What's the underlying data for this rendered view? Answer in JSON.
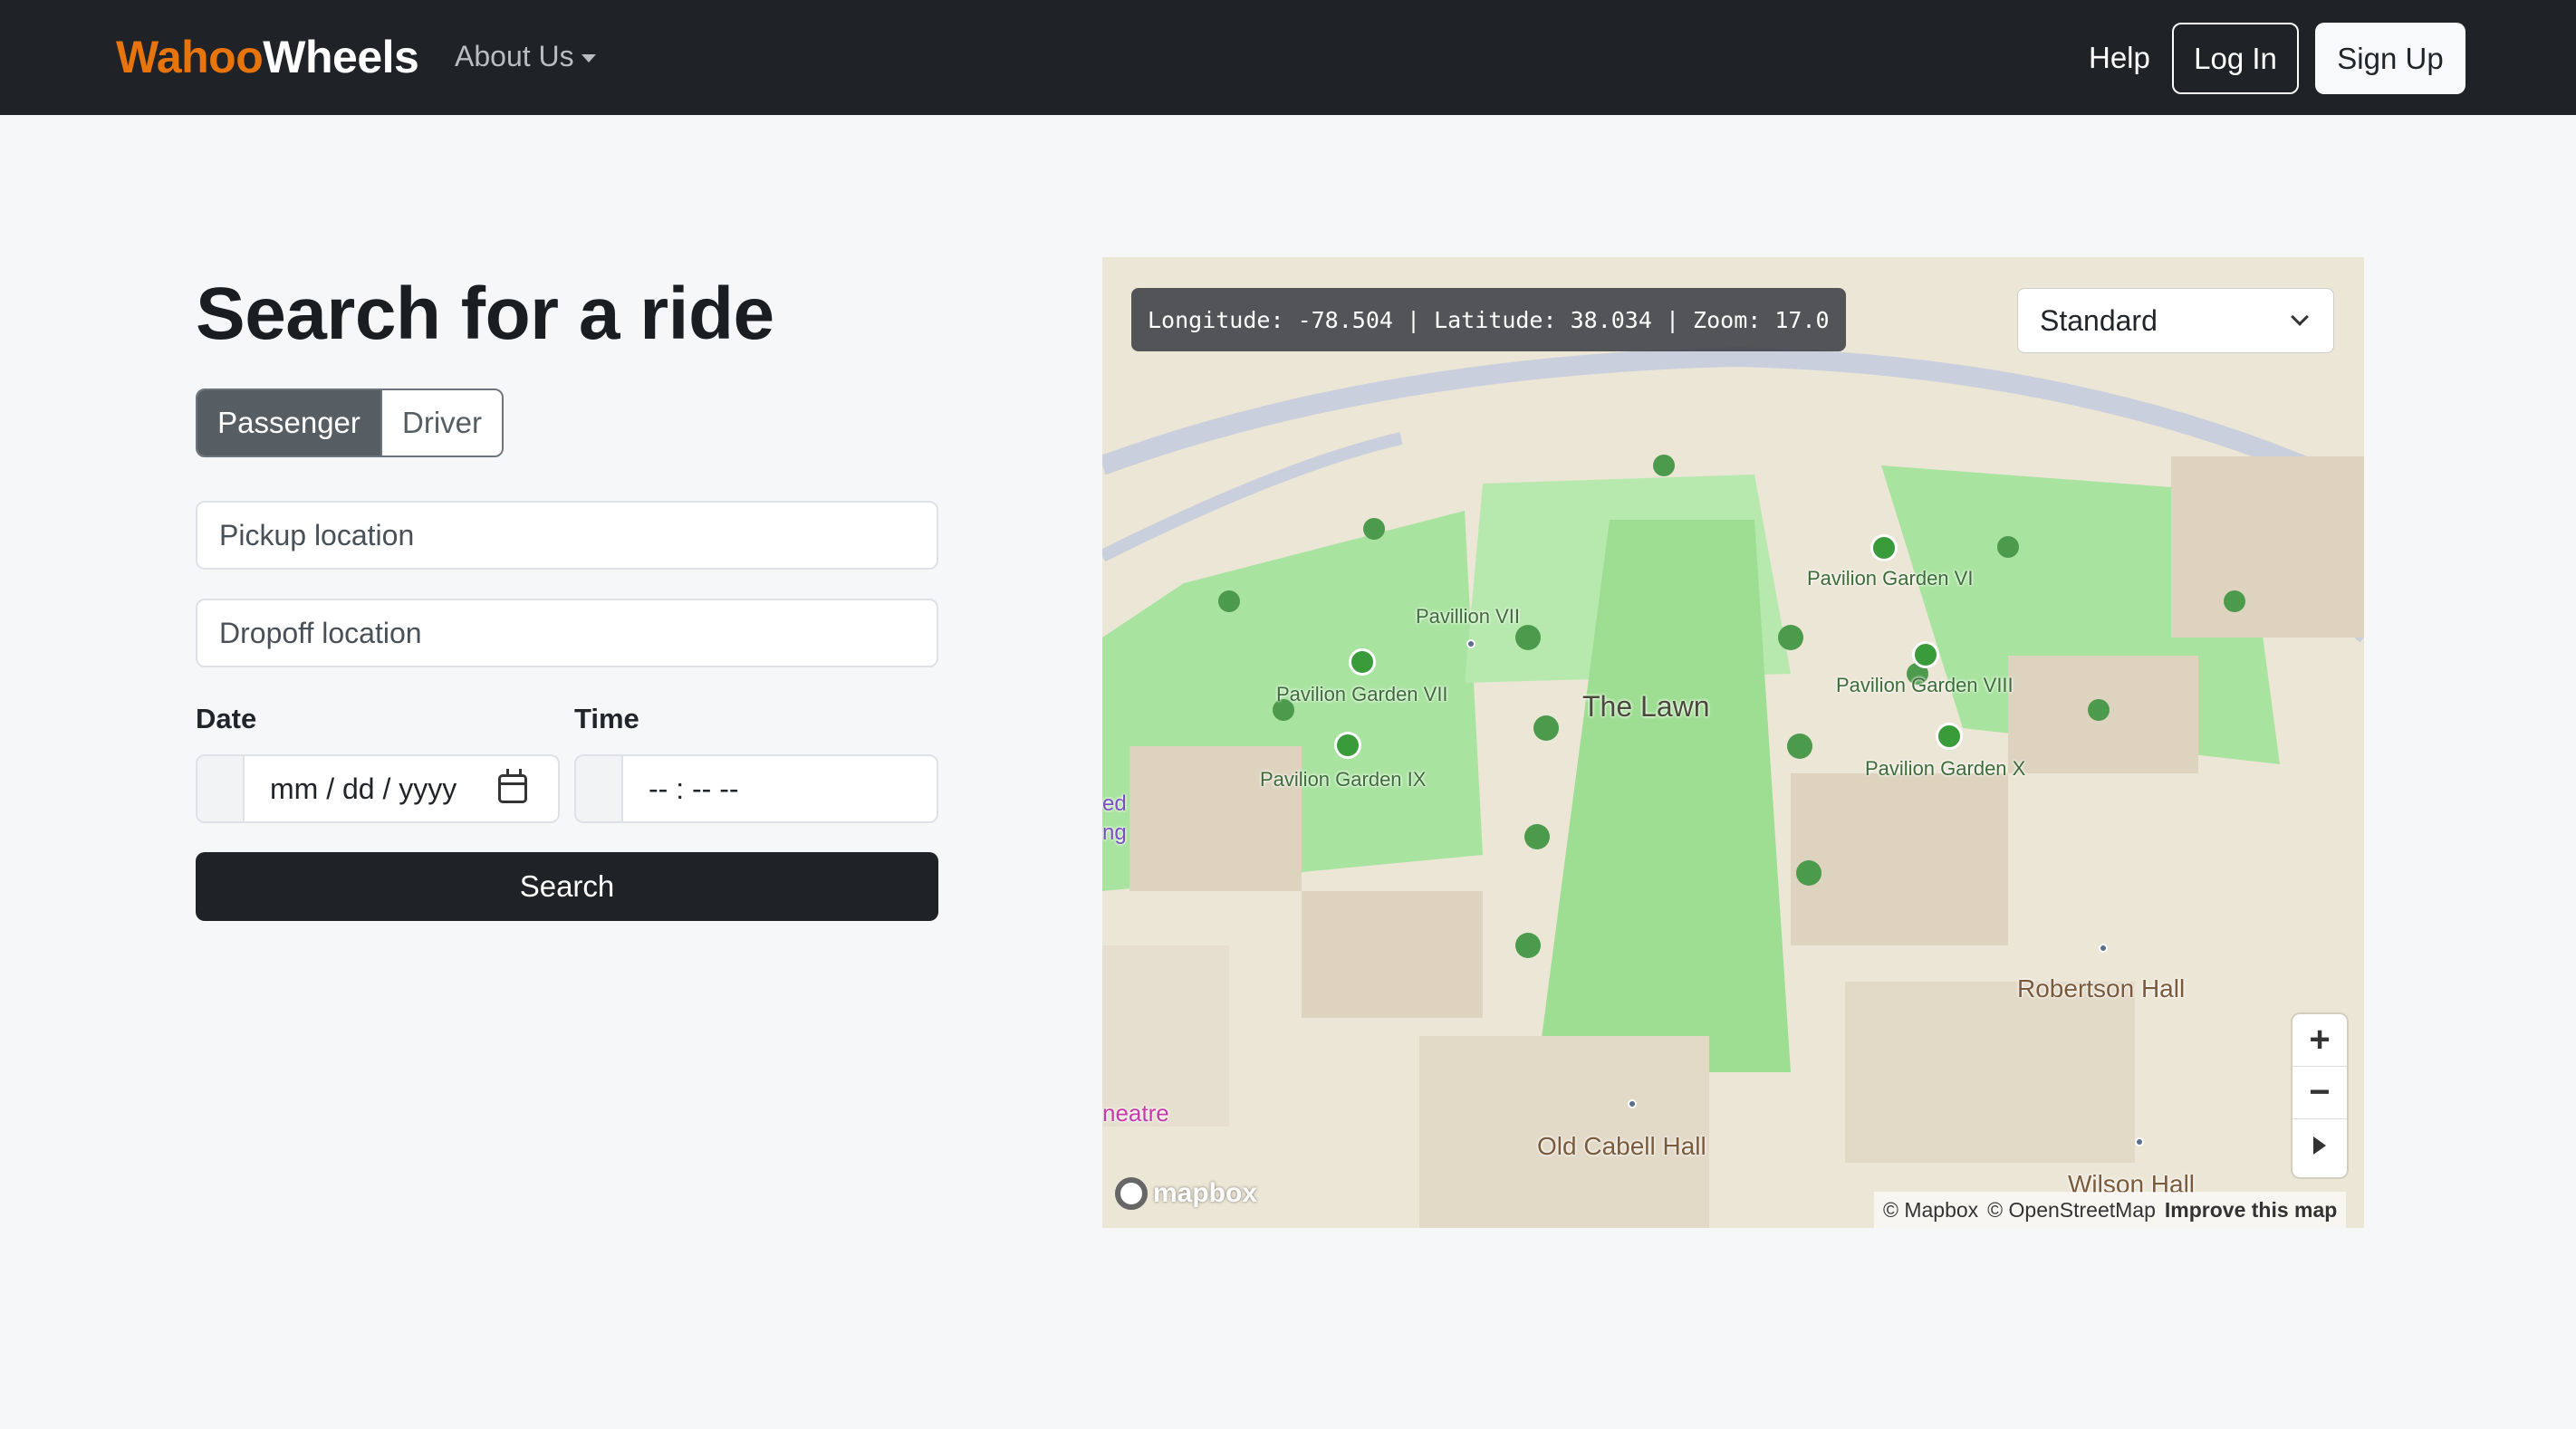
{
  "nav": {
    "brand_part1": "Wahoo",
    "brand_part2": "Wheels",
    "about": "About Us",
    "help": "Help",
    "login": "Log In",
    "signup": "Sign Up"
  },
  "form": {
    "title": "Search for a ride",
    "mode_passenger": "Passenger",
    "mode_driver": "Driver",
    "pickup_placeholder": "Pickup location",
    "dropoff_placeholder": "Dropoff location",
    "date_label": "Date",
    "time_label": "Time",
    "date_placeholder": "mm / dd / yyyy",
    "time_placeholder": "-- : --  --",
    "search": "Search"
  },
  "map": {
    "coords": "Longitude: -78.504 | Latitude: 38.034 | Zoom: 17.0",
    "style": "Standard",
    "labels": {
      "pav_vii": "Pavillion VII",
      "garden_vi": "Pavilion Garden VI",
      "garden_vii": "Pavilion Garden VII",
      "garden_viii": "Pavilion Garden VIII",
      "garden_ix": "Pavilion Garden IX",
      "garden_x": "Pavilion Garden X",
      "lawn": "The Lawn",
      "robertson": "Robertson Hall",
      "cabell": "Old Cabell Hall",
      "wilson": "Wilson Hall",
      "theatre": "neatre",
      "side1": "ed",
      "side2": "ng"
    },
    "logo": "mapbox",
    "attrib_mapbox": "© Mapbox",
    "attrib_osm": "© OpenStreetMap",
    "attrib_improve": "Improve this map"
  }
}
